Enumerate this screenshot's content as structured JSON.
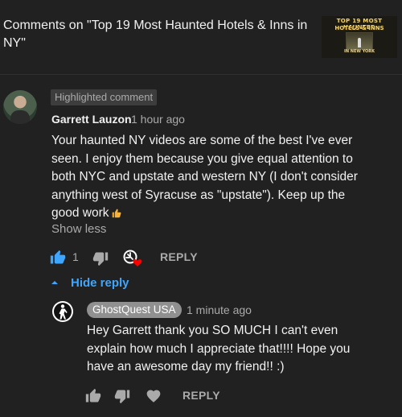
{
  "header": {
    "title": "Comments on \"Top 19 Most Haunted Hotels & Inns in NY\"",
    "thumbnail": {
      "line1": "TOP 19 MOST HAUNTED",
      "line2": "HOTELS & INNS",
      "line3": "IN NEW YORK"
    }
  },
  "comment": {
    "badge": "Highlighted comment",
    "author": "Garrett Lauzon",
    "time": "1 hour ago",
    "text": "Your haunted NY videos are some of the best I've ever seen. I enjoy them because you give equal attention to both NYC and upstate and western NY (I don't consider anything west of Syracuse as \"upstate\"). Keep up the good work",
    "emoji": "thumbs-up",
    "show_less": "Show less",
    "like_count": "1",
    "reply_label": "REPLY",
    "hide_reply": "Hide reply",
    "icons": [
      "thumb-up-icon",
      "thumb-down-icon",
      "creator-heart-icon",
      "chevron-up-icon"
    ]
  },
  "reply": {
    "author": "GhostQuest USA",
    "time": "1 minute ago",
    "text": "Hey Garrett thank you SO MUCH I can't even explain how much I appreciate that!!!! Hope you have an awesome day my friend!! :)",
    "reply_label": "REPLY",
    "icons": [
      "thumb-up-icon",
      "thumb-down-icon",
      "heart-icon"
    ]
  },
  "colors": {
    "background": "#212121",
    "text": "#f1f1f1",
    "secondary_text": "#aaaaaa",
    "link_blue": "#3ea6ff",
    "heart_red": "#ff0000",
    "emoji_yellow": "#f9b233"
  }
}
